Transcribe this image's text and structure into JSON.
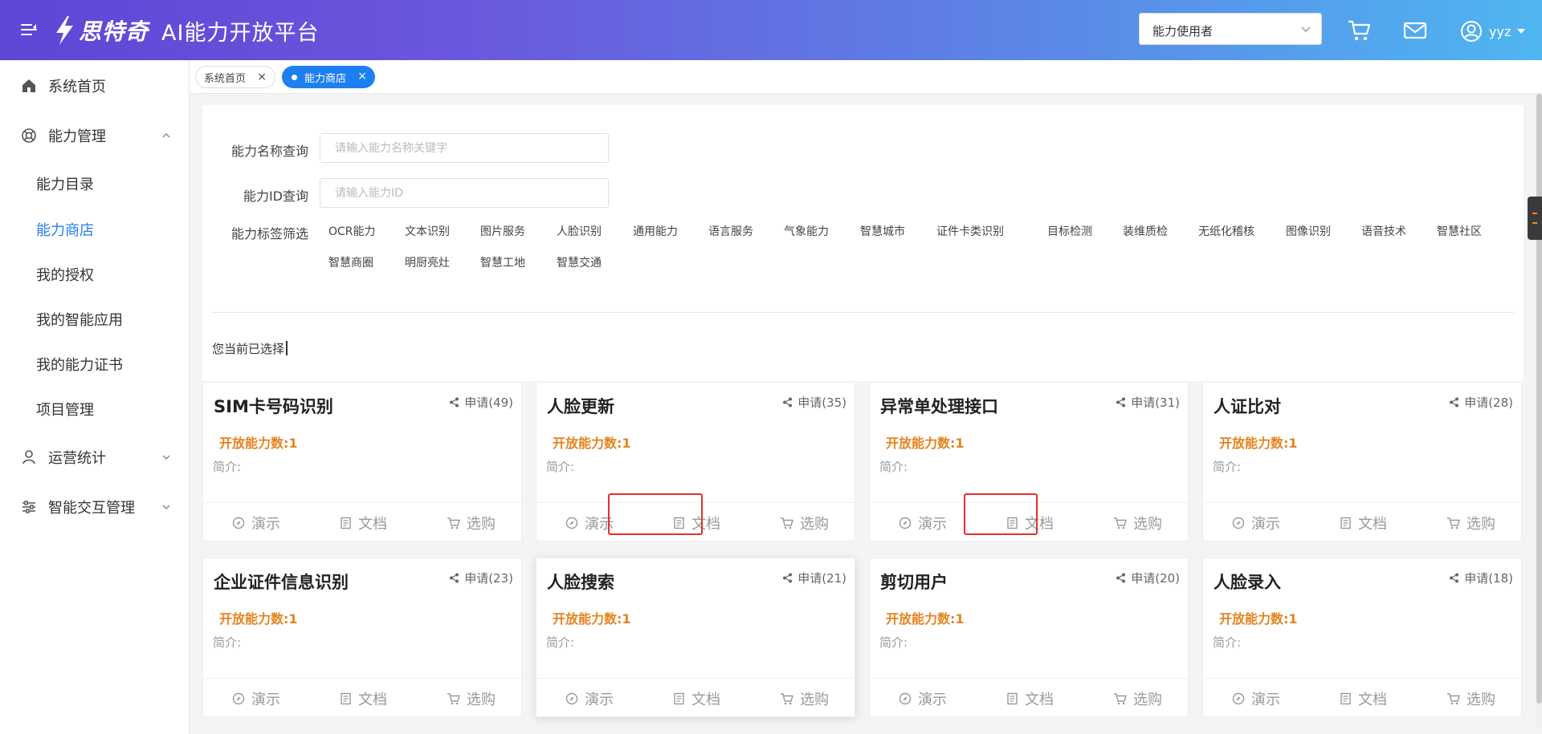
{
  "header": {
    "brand": "思特奇",
    "platform_title": "AI能力开放平台",
    "role_select": {
      "value": "能力使用者"
    },
    "user": {
      "name": "yyz"
    },
    "icons": [
      "menu-toggle-icon",
      "cart-icon",
      "mail-icon",
      "user-circle-icon"
    ]
  },
  "sidebar": {
    "items": [
      {
        "label": "系统首页",
        "icon": "home-icon"
      },
      {
        "label": "能力管理",
        "icon": "capability-icon",
        "expanded": true,
        "children": [
          {
            "label": "能力目录"
          },
          {
            "label": "能力商店",
            "active": true
          },
          {
            "label": "我的授权"
          },
          {
            "label": "我的智能应用"
          },
          {
            "label": "我的能力证书"
          },
          {
            "label": "项目管理"
          }
        ]
      },
      {
        "label": "运营统计",
        "icon": "user-stat-icon",
        "expanded": false
      },
      {
        "label": "智能交互管理",
        "icon": "sliders-icon",
        "expanded": false
      }
    ]
  },
  "tabs": [
    {
      "label": "系统首页",
      "active": false
    },
    {
      "label": "能力商店",
      "active": true
    }
  ],
  "filter": {
    "name_label": "能力名称查询",
    "name_placeholder": "请输入能力名称关键字",
    "name_value": "",
    "id_label": "能力ID查询",
    "id_placeholder": "请输入能力ID",
    "id_value": "",
    "tag_label": "能力标签筛选",
    "tags_row1": [
      "OCR能力",
      "文本识别",
      "图片服务",
      "人脸识别",
      "通用能力",
      "语言服务",
      "气象能力",
      "智慧城市",
      "证件卡类识别",
      "目标检测",
      "装维质检",
      "无纸化稽核",
      "图像识别",
      "语音技术",
      "智慧社区"
    ],
    "tags_row2": [
      "智慧商圈",
      "明厨亮灶",
      "智慧工地",
      "智慧交通"
    ],
    "selected_label": "您当前已选择"
  },
  "card_labels": {
    "open_count": "开放能力数:1",
    "intro": "简介:",
    "demo": "演示",
    "docs": "文档",
    "buy": "选购"
  },
  "cards": [
    {
      "title": "SIM卡号码识别",
      "apply": "申请(49)"
    },
    {
      "title": "人脸更新",
      "apply": "申请(35)"
    },
    {
      "title": "异常单处理接口",
      "apply": "申请(31)"
    },
    {
      "title": "人证比对",
      "apply": "申请(28)"
    },
    {
      "title": "企业证件信息识别",
      "apply": "申请(23)"
    },
    {
      "title": "人脸搜索",
      "apply": "申请(21)"
    },
    {
      "title": "剪切用户",
      "apply": "申请(20)"
    },
    {
      "title": "人脸录入",
      "apply": "申请(18)"
    }
  ],
  "colors": {
    "active": "#1e7ff0",
    "open_count": "#e6821e",
    "highlight": "#e52e2e"
  }
}
